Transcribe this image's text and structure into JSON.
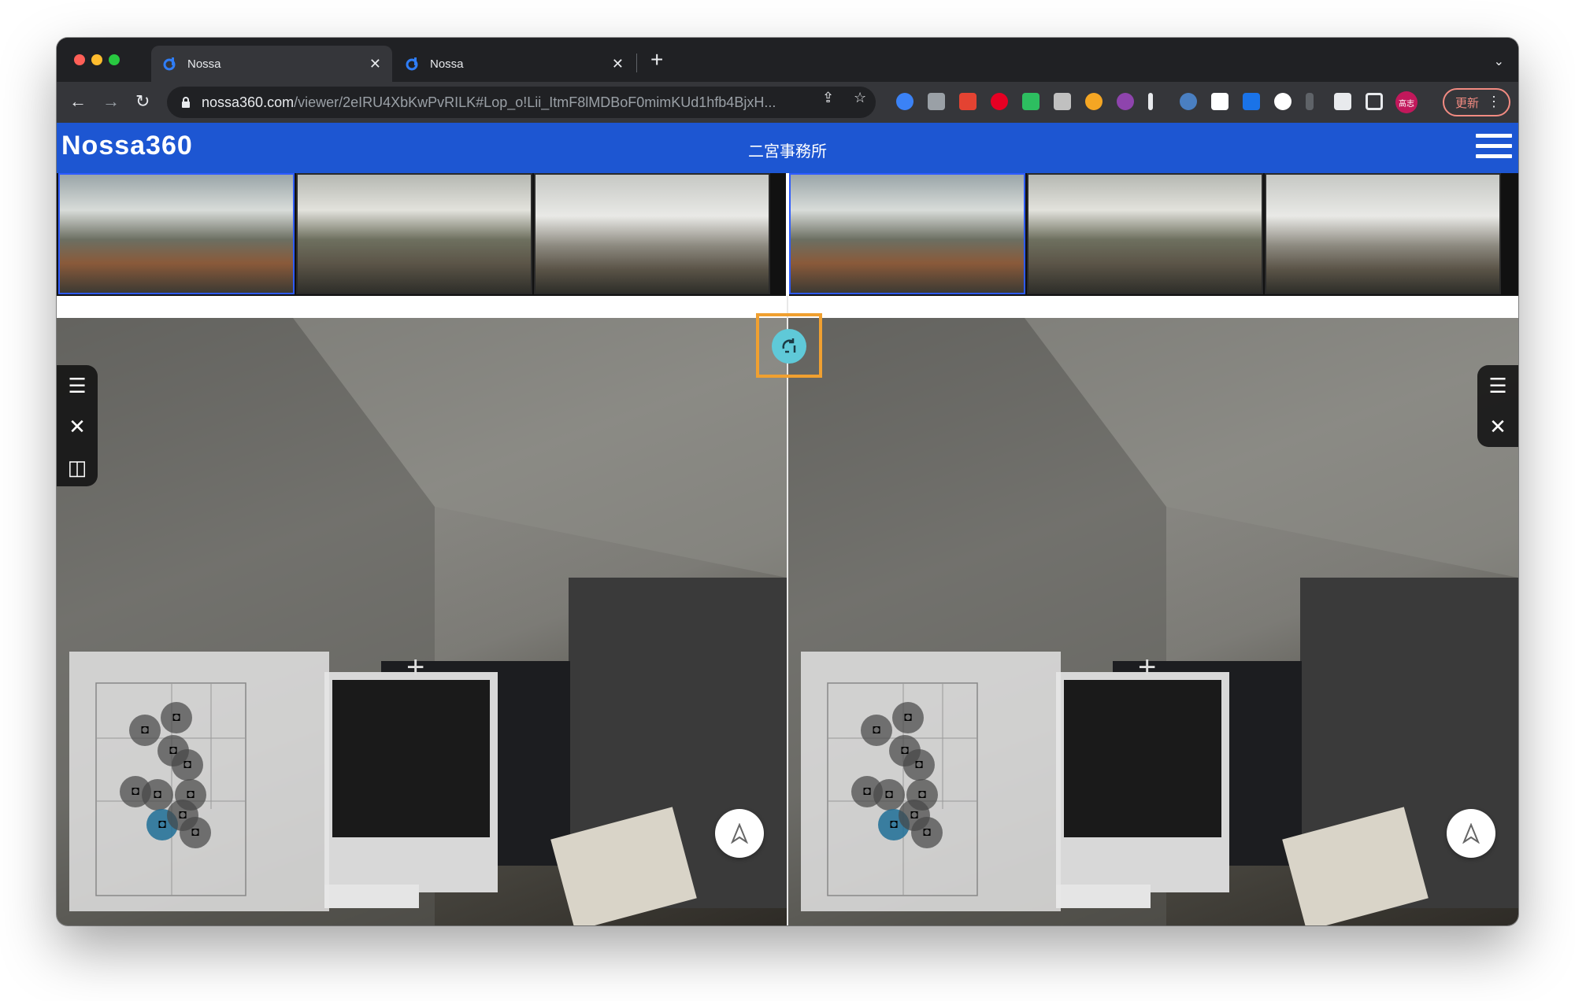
{
  "browser": {
    "tabs": [
      {
        "title": "Nossa",
        "active": true
      },
      {
        "title": "Nossa",
        "active": false
      }
    ],
    "url_host": "nossa360.com",
    "url_path": "/viewer/2eIRU4XbKwPvRILK#Lop_o!Lii_ItmF8lMDBoF0mimKUd1hfb4BjxH...",
    "profile_label": "高志",
    "update_label": "更新"
  },
  "app": {
    "logo_text": "Nossa360",
    "page_title": "二宮事務所",
    "brand_color": "#1d56d2",
    "sync_color": "#5fc9d8"
  },
  "panes": [
    {
      "name": "left",
      "selected_thumb": 0,
      "thumb_count": 3
    },
    {
      "name": "right",
      "selected_thumb": 0,
      "thumb_count": 3
    }
  ],
  "icons": [
    "list-icon",
    "close-icon",
    "split-view-icon",
    "sync-icon",
    "camera-icon",
    "compass-icon",
    "crosshair-icon",
    "menu-icon"
  ]
}
